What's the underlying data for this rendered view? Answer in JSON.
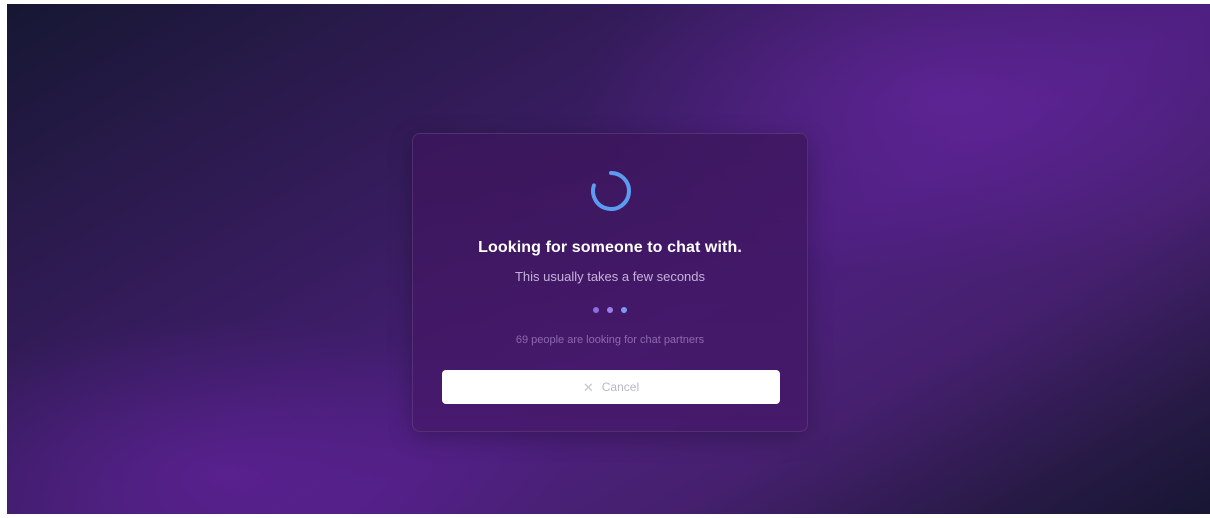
{
  "matching": {
    "title": "Looking for someone to chat with.",
    "subtitle": "This usually takes a few seconds",
    "status_text": "69 people are looking for chat partners",
    "cancel_label": "Cancel",
    "cancel_icon": "close-icon",
    "spinner_icon": "loading-spinner-icon"
  },
  "colors": {
    "spinner": "#5b9cf2",
    "dot_1": "#8a6fe0",
    "dot_2": "#9b7fe8",
    "dot_3": "#7b9bf0"
  }
}
